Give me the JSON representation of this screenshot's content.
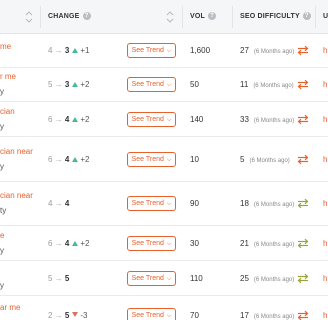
{
  "header": {
    "change_label": "CHANGE",
    "vol_label": "VOL",
    "seo_label": "SEO DIFFICULTY",
    "last_label": "U",
    "help_glyph": "?"
  },
  "trend_label": "See Trend",
  "chevron_glyph": "⌵",
  "arrow_glyph": "→",
  "rows": [
    {
      "kw": "me",
      "sub": "",
      "from": "4",
      "to": "3",
      "dir": "up",
      "delta": "+1",
      "vol": "1,600",
      "seo": "27",
      "ago": "(6 Months ago)",
      "refresh_color": "#e8612c",
      "h": "h"
    },
    {
      "kw": "r me",
      "sub": "y",
      "from": "5",
      "to": "3",
      "dir": "up",
      "delta": "+2",
      "vol": "50",
      "seo": "11",
      "ago": "(6 Months ago)",
      "refresh_color": "#e8612c",
      "h": "h"
    },
    {
      "kw": "cian",
      "sub": "y",
      "from": "6",
      "to": "4",
      "dir": "up",
      "delta": "+2",
      "vol": "140",
      "seo": "33",
      "ago": "(6 Months ago)",
      "refresh_color": "#e8612c",
      "h": "h"
    },
    {
      "kw": "cian near",
      "sub": "y",
      "from": "6",
      "to": "4",
      "dir": "up",
      "delta": "+2",
      "vol": "10",
      "seo": "5",
      "ago": "(6 Months ago)",
      "refresh_color": "#e8612c",
      "h": "h"
    },
    {
      "kw": "cian near",
      "sub": "ty",
      "from": "4",
      "to": "4",
      "dir": "none",
      "delta": "",
      "vol": "90",
      "seo": "18",
      "ago": "(6 Months ago)",
      "refresh_color": "#9aa33a",
      "h": "h"
    },
    {
      "kw": "e",
      "sub": "y",
      "from": "6",
      "to": "4",
      "dir": "up",
      "delta": "+2",
      "vol": "30",
      "seo": "21",
      "ago": "(6 Months ago)",
      "refresh_color": "#9aa33a",
      "h": "h"
    },
    {
      "kw": "",
      "sub": "y",
      "from": "5",
      "to": "5",
      "dir": "none",
      "delta": "",
      "vol": "110",
      "seo": "25",
      "ago": "(6 Months ago)",
      "refresh_color": "#9aa33a",
      "h": "h"
    },
    {
      "kw": "ar me",
      "sub": "y",
      "from": "2",
      "to": "5",
      "dir": "down",
      "delta": "-3",
      "vol": "70",
      "seo": "17",
      "ago": "(6 Months ago)",
      "refresh_color": "#e8612c",
      "h": "h"
    }
  ]
}
